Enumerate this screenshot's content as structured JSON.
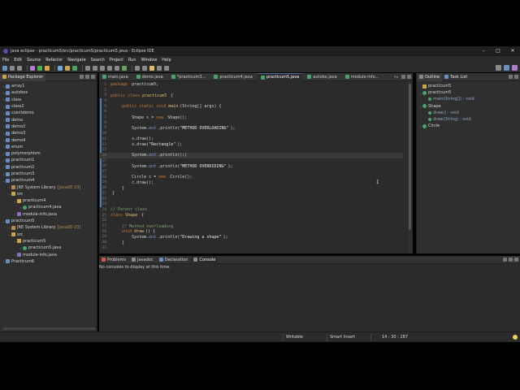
{
  "window": {
    "title": "java eclipse - practicum5/src/practicum5/practicum5.java - Eclipse IDE",
    "controls": [
      "–",
      "□",
      "✕"
    ]
  },
  "menu": [
    "File",
    "Edit",
    "Source",
    "Refactor",
    "Navigate",
    "Search",
    "Project",
    "Run",
    "Window",
    "Help"
  ],
  "package_explorer": {
    "tab": "Package Explorer",
    "items": [
      {
        "label": "array1",
        "level": 0,
        "icon": "proj",
        "arrow": "›"
      },
      {
        "label": "autobox",
        "level": 0,
        "icon": "proj",
        "arrow": "›"
      },
      {
        "label": "class",
        "level": 0,
        "icon": "proj",
        "arrow": "›"
      },
      {
        "label": "class2",
        "level": 0,
        "icon": "proj",
        "arrow": "›"
      },
      {
        "label": "cosntdemo",
        "level": 0,
        "icon": "proj",
        "arrow": "›"
      },
      {
        "label": "demo",
        "level": 0,
        "icon": "proj",
        "arrow": "›"
      },
      {
        "label": "demo2",
        "level": 0,
        "icon": "proj",
        "arrow": "›"
      },
      {
        "label": "demo3",
        "level": 0,
        "icon": "proj",
        "arrow": "›"
      },
      {
        "label": "demo4",
        "level": 0,
        "icon": "proj",
        "arrow": "›"
      },
      {
        "label": "enum",
        "level": 0,
        "icon": "proj",
        "arrow": "›"
      },
      {
        "label": "polymorphism",
        "level": 0,
        "icon": "proj",
        "arrow": "›"
      },
      {
        "label": "practicum1",
        "level": 0,
        "icon": "proj",
        "arrow": "›"
      },
      {
        "label": "practicum2",
        "level": 0,
        "icon": "proj",
        "arrow": "›"
      },
      {
        "label": "practicum3",
        "level": 0,
        "icon": "proj",
        "arrow": "›"
      },
      {
        "label": "practicum4",
        "level": 0,
        "icon": "proj",
        "arrow": "⌄"
      },
      {
        "label": "JRE System Library",
        "sub": "[JavaSE-23]",
        "level": 1,
        "icon": "lib",
        "arrow": "›"
      },
      {
        "label": "src",
        "level": 1,
        "icon": "src",
        "arrow": "⌄"
      },
      {
        "label": "practicum4",
        "level": 2,
        "icon": "pkg",
        "arrow": "⌄"
      },
      {
        "label": "practicum4.java",
        "level": 3,
        "icon": "java",
        "arrow": "›"
      },
      {
        "label": "module-info.java",
        "level": 2,
        "icon": "mod",
        "arrow": "›"
      },
      {
        "label": "practicum5",
        "level": 0,
        "icon": "proj",
        "arrow": "⌄"
      },
      {
        "label": "JRE System Library",
        "sub": "[JavaSE-23]",
        "level": 1,
        "icon": "lib",
        "arrow": "›"
      },
      {
        "label": "src",
        "level": 1,
        "icon": "src",
        "arrow": "⌄"
      },
      {
        "label": "practicum5",
        "level": 2,
        "icon": "pkg",
        "arrow": "⌄"
      },
      {
        "label": "practicum5.java",
        "level": 3,
        "icon": "java",
        "arrow": "›"
      },
      {
        "label": "module-info.java",
        "level": 2,
        "icon": "mod",
        "arrow": "›"
      },
      {
        "label": "Practicum6",
        "level": 0,
        "icon": "proj",
        "arrow": "›"
      }
    ]
  },
  "editor": {
    "tabs": [
      {
        "label": "main.java",
        "active": false
      },
      {
        "label": "demo.java",
        "active": false
      },
      {
        "label": "*practicum3...",
        "active": false
      },
      {
        "label": "practicum4.java",
        "active": false
      },
      {
        "label": "practicum5.java",
        "active": true
      },
      {
        "label": "autobx.java",
        "active": false
      },
      {
        "label": "module-info...",
        "active": false
      }
    ],
    "overflow": "»₈",
    "lines": [
      {
        "n": "1",
        "segs": [
          [
            "kw",
            "package "
          ],
          [
            "tx",
            "practicum5;"
          ]
        ]
      },
      {
        "n": "2",
        "segs": []
      },
      {
        "n": "3",
        "segs": [
          [
            "kw",
            "public class "
          ],
          [
            "ty",
            "practicum5 "
          ],
          [
            "tx",
            "{"
          ]
        ]
      },
      {
        "n": "4",
        "segs": []
      },
      {
        "n": "5",
        "segs": [
          [
            "tx",
            "    "
          ],
          [
            "kw",
            "public static void "
          ],
          [
            "mth",
            "main"
          ],
          [
            "tx",
            "(String[] args) {"
          ]
        ]
      },
      {
        "n": "6",
        "segs": []
      },
      {
        "n": "7",
        "segs": [
          [
            "tx",
            "        Shape s = "
          ],
          [
            "kw",
            "new "
          ],
          [
            "tx",
            "Shape();"
          ]
        ]
      },
      {
        "n": "8",
        "segs": []
      },
      {
        "n": "9",
        "segs": [
          [
            "tx",
            "        System."
          ],
          [
            "fld",
            "out"
          ],
          [
            "tx",
            ".println("
          ],
          [
            "st",
            "\"METHOD OVERLOADING\""
          ],
          [
            "tx",
            ");"
          ]
        ]
      },
      {
        "n": "10",
        "segs": []
      },
      {
        "n": "11",
        "segs": [
          [
            "tx",
            "        s.draw();"
          ]
        ]
      },
      {
        "n": "12",
        "segs": [
          [
            "tx",
            "        s.draw("
          ],
          [
            "st",
            "\"Rectangle\""
          ],
          [
            "tx",
            ");"
          ]
        ]
      },
      {
        "n": "13",
        "segs": []
      },
      {
        "n": "14",
        "segs": [
          [
            "tx",
            "        System."
          ],
          [
            "fld",
            "out"
          ],
          [
            "tx",
            ".println();|"
          ]
        ],
        "hl": true
      },
      {
        "n": "15",
        "segs": []
      },
      {
        "n": "16",
        "segs": [
          [
            "tx",
            "        System."
          ],
          [
            "fld",
            "out"
          ],
          [
            "tx",
            ".println("
          ],
          [
            "st",
            "\"METHOD OVERRIDING\""
          ],
          [
            "tx",
            ");"
          ]
        ]
      },
      {
        "n": "17",
        "segs": []
      },
      {
        "n": "18",
        "segs": [
          [
            "tx",
            "        Circle c = "
          ],
          [
            "kw",
            "new "
          ],
          [
            "tx",
            "Circle();"
          ]
        ]
      },
      {
        "n": "19",
        "segs": [
          [
            "tx",
            "        c.draw();"
          ]
        ]
      },
      {
        "n": "20",
        "segs": [
          [
            "tx",
            "    }"
          ]
        ]
      },
      {
        "n": "21",
        "segs": [
          [
            "tx",
            "}"
          ]
        ]
      },
      {
        "n": "22",
        "segs": []
      },
      {
        "n": "23",
        "segs": []
      },
      {
        "n": "24",
        "segs": [
          [
            "cm",
            "// Parent class"
          ]
        ]
      },
      {
        "n": "25",
        "segs": [
          [
            "kw",
            "class "
          ],
          [
            "ty",
            "Shape "
          ],
          [
            "tx",
            "{"
          ]
        ]
      },
      {
        "n": "26",
        "segs": []
      },
      {
        "n": "27",
        "segs": [
          [
            "tx",
            "    "
          ],
          [
            "cm",
            "// Method overloading"
          ]
        ]
      },
      {
        "n": "28",
        "segs": [
          [
            "tx",
            "    "
          ],
          [
            "kw",
            "void "
          ],
          [
            "mth",
            "draw"
          ],
          [
            "tx",
            "() {"
          ]
        ]
      },
      {
        "n": "29",
        "segs": [
          [
            "tx",
            "        System."
          ],
          [
            "fld",
            "out"
          ],
          [
            "tx",
            ".println("
          ],
          [
            "st",
            "\"Drawing a shape\""
          ],
          [
            "tx",
            ");"
          ]
        ]
      },
      {
        "n": "30",
        "segs": [
          [
            "tx",
            "    }"
          ]
        ]
      },
      {
        "n": "31",
        "segs": []
      }
    ]
  },
  "outline": {
    "tabs": [
      "Outline",
      "Task List"
    ],
    "items": [
      {
        "label": "practicum5",
        "level": 0,
        "icon": "pkgo",
        "arrow": ""
      },
      {
        "label": "practicum5",
        "level": 0,
        "icon": "cls",
        "arrow": "⌄"
      },
      {
        "label": "main(String[]) : void",
        "level": 1,
        "icon": "meth",
        "arrow": ""
      },
      {
        "label": "Shape",
        "level": 0,
        "icon": "cls",
        "arrow": "⌄"
      },
      {
        "label": "draw() : void",
        "level": 1,
        "icon": "meth",
        "arrow": ""
      },
      {
        "label": "draw(String) : void",
        "level": 1,
        "icon": "meth",
        "arrow": ""
      },
      {
        "label": "Circle",
        "level": 0,
        "icon": "cls",
        "arrow": "›"
      }
    ]
  },
  "console": {
    "tabs": [
      "Problems",
      "Javadoc",
      "Declaration",
      "Console"
    ],
    "active": "Console",
    "message": "No consoles to display at this time."
  },
  "status": {
    "writable": "Writable",
    "insert": "Smart Insert",
    "position": "14 : 30 : 287"
  },
  "colors": {
    "accent": "#4a6fa5",
    "background": "#2b2b2b"
  }
}
